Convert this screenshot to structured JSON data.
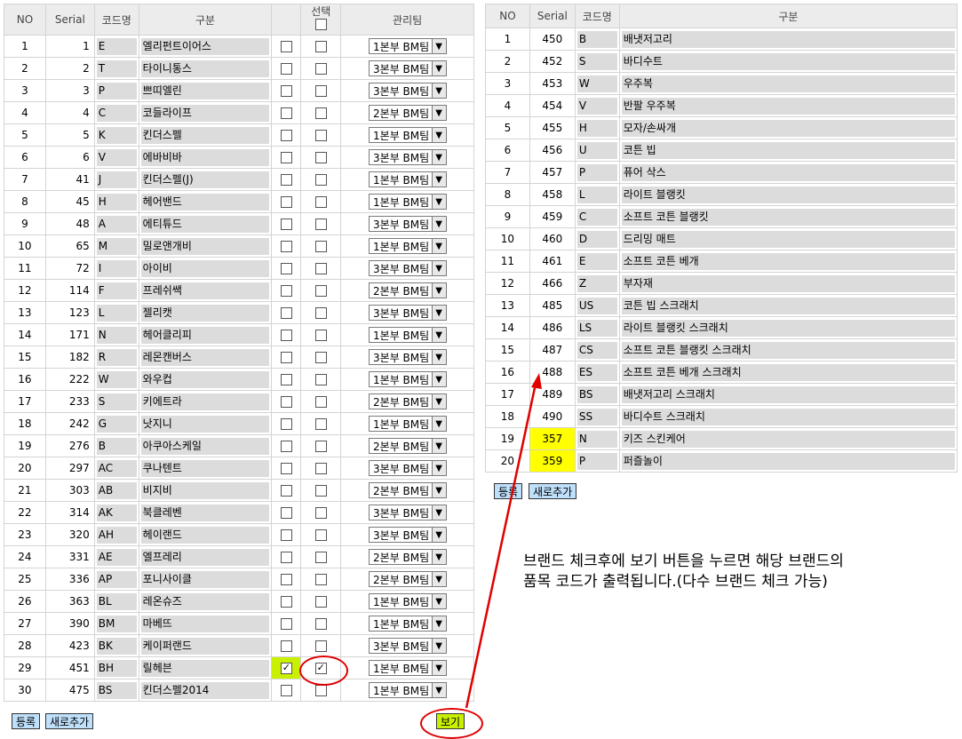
{
  "left_table": {
    "headers": {
      "no": "NO",
      "serial": "Serial",
      "code": "코드명",
      "name": "구분",
      "select": "선택",
      "team": "관리팀"
    },
    "rows": [
      {
        "no": "1",
        "serial": "1",
        "code": "E",
        "name": "엘리펀트이어스",
        "team": "1본부 BM팀"
      },
      {
        "no": "2",
        "serial": "2",
        "code": "T",
        "name": "타이니통스",
        "team": "3본부 BM팀"
      },
      {
        "no": "3",
        "serial": "3",
        "code": "P",
        "name": "쁘띠엘린",
        "team": "3본부 BM팀"
      },
      {
        "no": "4",
        "serial": "4",
        "code": "C",
        "name": "코들라이프",
        "team": "2본부 BM팀"
      },
      {
        "no": "5",
        "serial": "5",
        "code": "K",
        "name": "킨더스펠",
        "team": "1본부 BM팀"
      },
      {
        "no": "6",
        "serial": "6",
        "code": "V",
        "name": "에바비바",
        "team": "3본부 BM팀"
      },
      {
        "no": "7",
        "serial": "41",
        "code": "J",
        "name": "킨더스펠(J)",
        "team": "1본부 BM팀"
      },
      {
        "no": "8",
        "serial": "45",
        "code": "H",
        "name": "헤어밴드",
        "team": "1본부 BM팀"
      },
      {
        "no": "9",
        "serial": "48",
        "code": "A",
        "name": "에티튜드",
        "team": "3본부 BM팀"
      },
      {
        "no": "10",
        "serial": "65",
        "code": "M",
        "name": "밀로앤개비",
        "team": "1본부 BM팀"
      },
      {
        "no": "11",
        "serial": "72",
        "code": "I",
        "name": "아이비",
        "team": "3본부 BM팀"
      },
      {
        "no": "12",
        "serial": "114",
        "code": "F",
        "name": "프레쉬쌕",
        "team": "2본부 BM팀"
      },
      {
        "no": "13",
        "serial": "123",
        "code": "L",
        "name": "젤리캣",
        "team": "3본부 BM팀"
      },
      {
        "no": "14",
        "serial": "171",
        "code": "N",
        "name": "헤어클리피",
        "team": "1본부 BM팀"
      },
      {
        "no": "15",
        "serial": "182",
        "code": "R",
        "name": "레몬캔버스",
        "team": "3본부 BM팀"
      },
      {
        "no": "16",
        "serial": "222",
        "code": "W",
        "name": "와우컵",
        "team": "1본부 BM팀"
      },
      {
        "no": "17",
        "serial": "233",
        "code": "S",
        "name": "키에트라",
        "team": "2본부 BM팀"
      },
      {
        "no": "18",
        "serial": "242",
        "code": "G",
        "name": "낫지니",
        "team": "1본부 BM팀"
      },
      {
        "no": "19",
        "serial": "276",
        "code": "B",
        "name": "아쿠아스케일",
        "team": "2본부 BM팀"
      },
      {
        "no": "20",
        "serial": "297",
        "code": "AC",
        "name": "쿠나텐트",
        "team": "3본부 BM팀"
      },
      {
        "no": "21",
        "serial": "303",
        "code": "AB",
        "name": "비지비",
        "team": "2본부 BM팀"
      },
      {
        "no": "22",
        "serial": "314",
        "code": "AK",
        "name": "북클레벤",
        "team": "3본부 BM팀"
      },
      {
        "no": "23",
        "serial": "320",
        "code": "AH",
        "name": "헤이랜드",
        "team": "3본부 BM팀"
      },
      {
        "no": "24",
        "serial": "331",
        "code": "AE",
        "name": "엘프레리",
        "team": "2본부 BM팀"
      },
      {
        "no": "25",
        "serial": "336",
        "code": "AP",
        "name": "포니사이클",
        "team": "2본부 BM팀"
      },
      {
        "no": "26",
        "serial": "363",
        "code": "BL",
        "name": "레온슈즈",
        "team": "1본부 BM팀"
      },
      {
        "no": "27",
        "serial": "390",
        "code": "BM",
        "name": "마베뜨",
        "team": "1본부 BM팀"
      },
      {
        "no": "28",
        "serial": "423",
        "code": "BK",
        "name": "케이퍼랜드",
        "team": "3본부 BM팀"
      },
      {
        "no": "29",
        "serial": "451",
        "code": "BH",
        "name": "릴헤븐",
        "team": "1본부 BM팀",
        "checked": true
      },
      {
        "no": "30",
        "serial": "475",
        "code": "BS",
        "name": "킨더스펠2014",
        "team": "1본부 BM팀"
      }
    ],
    "register_label": "등록",
    "add_new_label": "새로추가",
    "view_label": "보기"
  },
  "right_table": {
    "headers": {
      "no": "NO",
      "serial": "Serial",
      "code": "코드명",
      "name": "구분"
    },
    "rows": [
      {
        "no": "1",
        "serial": "450",
        "code": "B",
        "name": "배냇저고리"
      },
      {
        "no": "2",
        "serial": "452",
        "code": "S",
        "name": "바디수트"
      },
      {
        "no": "3",
        "serial": "453",
        "code": "W",
        "name": "우주복"
      },
      {
        "no": "4",
        "serial": "454",
        "code": "V",
        "name": "반팔 우주복"
      },
      {
        "no": "5",
        "serial": "455",
        "code": "H",
        "name": "모자/손싸개"
      },
      {
        "no": "6",
        "serial": "456",
        "code": "U",
        "name": "코튼 빕"
      },
      {
        "no": "7",
        "serial": "457",
        "code": "P",
        "name": "퓨어 삭스"
      },
      {
        "no": "8",
        "serial": "458",
        "code": "L",
        "name": "라이트 블랭킷"
      },
      {
        "no": "9",
        "serial": "459",
        "code": "C",
        "name": "소프트 코튼 블랭킷"
      },
      {
        "no": "10",
        "serial": "460",
        "code": "D",
        "name": "드리밍 매트"
      },
      {
        "no": "11",
        "serial": "461",
        "code": "E",
        "name": "소프트 코튼 베개"
      },
      {
        "no": "12",
        "serial": "466",
        "code": "Z",
        "name": "부자재"
      },
      {
        "no": "13",
        "serial": "485",
        "code": "US",
        "name": "코튼 빕 스크래치"
      },
      {
        "no": "14",
        "serial": "486",
        "code": "LS",
        "name": "라이트 블랭킷 스크래치"
      },
      {
        "no": "15",
        "serial": "487",
        "code": "CS",
        "name": "소프트 코튼 블랭킷 스크래치"
      },
      {
        "no": "16",
        "serial": "488",
        "code": "ES",
        "name": "소프트 코튼 베개 스크래치"
      },
      {
        "no": "17",
        "serial": "489",
        "code": "BS",
        "name": "배냇저고리 스크래치"
      },
      {
        "no": "18",
        "serial": "490",
        "code": "SS",
        "name": "바디수트 스크래치"
      },
      {
        "no": "19",
        "serial": "357",
        "code": "N",
        "name": "키즈 스킨케어",
        "highlight": true
      },
      {
        "no": "20",
        "serial": "359",
        "code": "P",
        "name": "퍼즐놀이",
        "highlight": true
      }
    ],
    "register_label": "등록",
    "add_new_label": "새로추가"
  },
  "annotation": {
    "line1": "브랜드 체크후에 보기 버튼을 누르면 해당 브랜드의",
    "line2": "품목 코드가 출력됩니다.(다수 브랜드 체크 가능)"
  },
  "colors": {
    "highlight_green": "#c8f000",
    "highlight_yellow": "#ffff00",
    "annotation_red": "#e00000",
    "button_blue": "#bfe0fb"
  }
}
